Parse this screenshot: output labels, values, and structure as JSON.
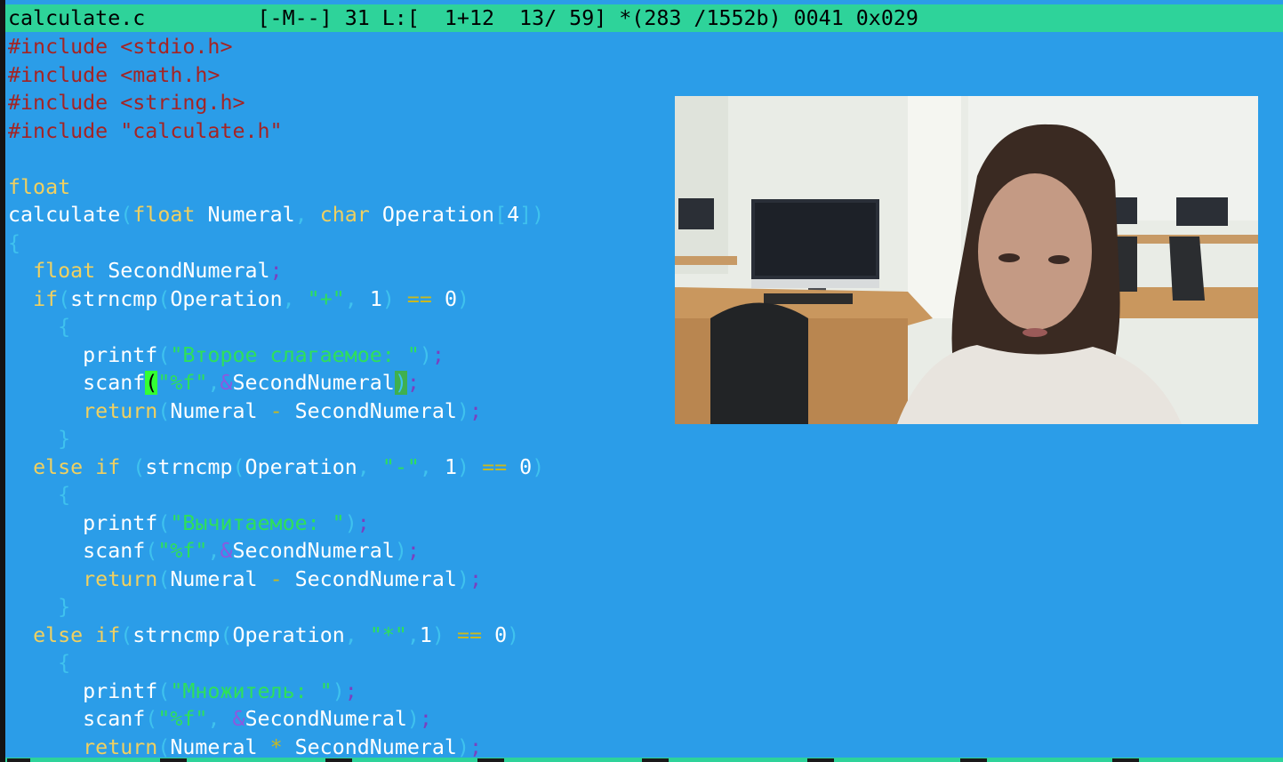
{
  "status_bar": {
    "text": "calculate.c         [-M--] 31 L:[  1+12  13/ 59] *(283 /1552b) 0041 0x029"
  },
  "code": {
    "l0": [
      "#include ",
      "<stdio.h>"
    ],
    "l1": [
      "#include ",
      "<math.h>"
    ],
    "l2": [
      "#include ",
      "<string.h>"
    ],
    "l3": [
      "#include ",
      "\"calculate.h\""
    ],
    "l5": [
      "float"
    ],
    "l6": [
      "calculate",
      "(",
      "float",
      " ",
      "Numeral",
      ",",
      " ",
      "char",
      " ",
      "Operation",
      "[",
      "4",
      "])"
    ],
    "l7": [
      "{"
    ],
    "l8": [
      "  ",
      "float",
      " ",
      "SecondNumeral",
      ";"
    ],
    "l9": [
      "  ",
      "if",
      "(",
      "strncmp",
      "(",
      "Operation",
      ",",
      " ",
      "\"+\"",
      ",",
      " ",
      "1",
      ")",
      " ",
      "==",
      " ",
      "0",
      ")"
    ],
    "l10": [
      "    ",
      "{"
    ],
    "l11": [
      "      ",
      "printf",
      "(",
      "\"Второе слагаемое: \"",
      ")",
      ";"
    ],
    "l12": [
      "      ",
      "scanf",
      "(",
      "\"%f\"",
      ",",
      "&",
      "SecondNumeral",
      ")",
      ";"
    ],
    "l13": [
      "      ",
      "return",
      "(",
      "Numeral",
      " ",
      "-",
      " ",
      "SecondNumeral",
      ")",
      ";"
    ],
    "l14": [
      "    ",
      "}"
    ],
    "l15": [
      "  ",
      "else",
      " ",
      "if",
      " ",
      "(",
      "strncmp",
      "(",
      "Operation",
      ",",
      " ",
      "\"-\"",
      ",",
      " ",
      "1",
      ")",
      " ",
      "==",
      " ",
      "0",
      ")"
    ],
    "l16": [
      "    ",
      "{"
    ],
    "l17": [
      "      ",
      "printf",
      "(",
      "\"Вычитаемое: \"",
      ")",
      ";"
    ],
    "l18": [
      "      ",
      "scanf",
      "(",
      "\"%f\"",
      ",",
      "&",
      "SecondNumeral",
      ")",
      ";"
    ],
    "l19": [
      "      ",
      "return",
      "(",
      "Numeral",
      " ",
      "-",
      " ",
      "SecondNumeral",
      ")",
      ";"
    ],
    "l20": [
      "    ",
      "}"
    ],
    "l21": [
      "  ",
      "else",
      " ",
      "if",
      "(",
      "strncmp",
      "(",
      "Operation",
      ",",
      " ",
      "\"*\"",
      ",",
      "1",
      ")",
      " ",
      "==",
      " ",
      "0",
      ")"
    ],
    "l22": [
      "    ",
      "{"
    ],
    "l23": [
      "      ",
      "printf",
      "(",
      "\"Множитель: \"",
      ")",
      ";"
    ],
    "l24": [
      "      ",
      "scanf",
      "(",
      "\"%f\"",
      ",",
      " ",
      "&",
      "SecondNumeral",
      ")",
      ";"
    ],
    "l25": [
      "      ",
      "return",
      "(",
      "Numeral",
      " ",
      "*",
      " ",
      "SecondNumeral",
      ")",
      ";"
    ]
  },
  "colors": {
    "editor_background": "#2b9de8",
    "status_bar": "#2ed39a",
    "preprocessor": "#a42424",
    "string": "#2ee05a",
    "keyword": "#f0d060",
    "identifier": "#ffffff",
    "cursor_bracket": "#33ff33"
  },
  "video_overlay": {
    "content": "webcam-feed"
  }
}
